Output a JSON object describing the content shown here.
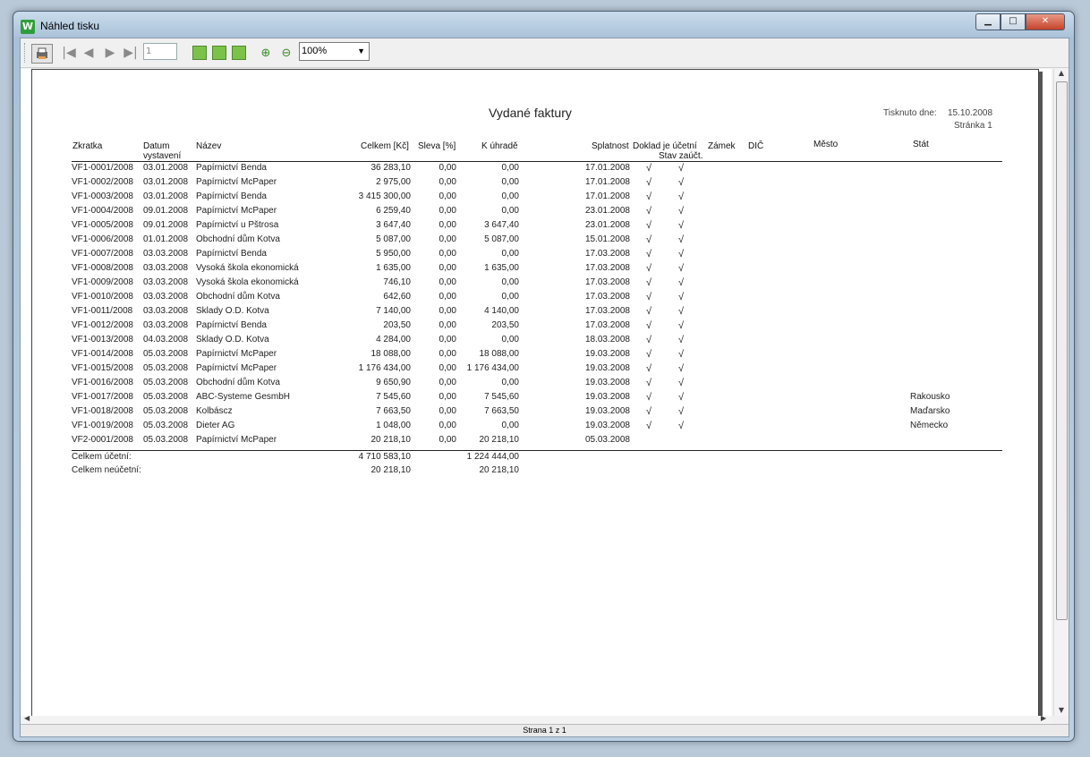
{
  "window": {
    "title": "Náhled tisku",
    "app_icon": "W"
  },
  "toolbar": {
    "page_value": "1",
    "zoom": "100%"
  },
  "report": {
    "title": "Vydané faktury",
    "printed_label": "Tisknuto dne:",
    "printed_date": "15.10.2008",
    "page_label": "Stránka 1",
    "headers": {
      "zkratka": "Zkratka",
      "datum": "Datum",
      "datum2": "vystavení",
      "nazev": "Název",
      "celkem": "Celkem [Kč]",
      "sleva": "Sleva [%]",
      "kuhrade": "K úhradě",
      "splatnost": "Splatnost",
      "doklad": "Doklad je účetní",
      "stav": "Stav zaúčt.",
      "zamek": "Zámek",
      "dic": "DIČ",
      "mesto": "Město",
      "stat": "Stát"
    },
    "rows": [
      {
        "z": "VF1-0001/2008",
        "d": "03.01.2008",
        "n": "Papírnictví Benda",
        "c": "36 283,10",
        "s": "0,00",
        "k": "0,00",
        "sp": "17.01.2008",
        "u": "√",
        "st": "√",
        "stat": ""
      },
      {
        "z": "VF1-0002/2008",
        "d": "03.01.2008",
        "n": "Papírnictví McPaper",
        "c": "2 975,00",
        "s": "0,00",
        "k": "0,00",
        "sp": "17.01.2008",
        "u": "√",
        "st": "√",
        "stat": ""
      },
      {
        "z": "VF1-0003/2008",
        "d": "03.01.2008",
        "n": "Papírnictví Benda",
        "c": "3 415 300,00",
        "s": "0,00",
        "k": "0,00",
        "sp": "17.01.2008",
        "u": "√",
        "st": "√",
        "stat": ""
      },
      {
        "z": "VF1-0004/2008",
        "d": "09.01.2008",
        "n": "Papírnictví McPaper",
        "c": "6 259,40",
        "s": "0,00",
        "k": "0,00",
        "sp": "23.01.2008",
        "u": "√",
        "st": "√",
        "stat": ""
      },
      {
        "z": "VF1-0005/2008",
        "d": "09.01.2008",
        "n": "Papírnictví u Pštrosa",
        "c": "3 647,40",
        "s": "0,00",
        "k": "3 647,40",
        "sp": "23.01.2008",
        "u": "√",
        "st": "√",
        "stat": ""
      },
      {
        "z": "VF1-0006/2008",
        "d": "01.01.2008",
        "n": "Obchodní dům Kotva",
        "c": "5 087,00",
        "s": "0,00",
        "k": "5 087,00",
        "sp": "15.01.2008",
        "u": "√",
        "st": "√",
        "stat": ""
      },
      {
        "z": "VF1-0007/2008",
        "d": "03.03.2008",
        "n": "Papírnictví Benda",
        "c": "5 950,00",
        "s": "0,00",
        "k": "0,00",
        "sp": "17.03.2008",
        "u": "√",
        "st": "√",
        "stat": ""
      },
      {
        "z": "VF1-0008/2008",
        "d": "03.03.2008",
        "n": "Vysoká škola ekonomická",
        "c": "1 635,00",
        "s": "0,00",
        "k": "1 635,00",
        "sp": "17.03.2008",
        "u": "√",
        "st": "√",
        "stat": ""
      },
      {
        "z": "VF1-0009/2008",
        "d": "03.03.2008",
        "n": "Vysoká škola ekonomická",
        "c": "746,10",
        "s": "0,00",
        "k": "0,00",
        "sp": "17.03.2008",
        "u": "√",
        "st": "√",
        "stat": ""
      },
      {
        "z": "VF1-0010/2008",
        "d": "03.03.2008",
        "n": "Obchodní dům Kotva",
        "c": "642,60",
        "s": "0,00",
        "k": "0,00",
        "sp": "17.03.2008",
        "u": "√",
        "st": "√",
        "stat": ""
      },
      {
        "z": "VF1-0011/2008",
        "d": "03.03.2008",
        "n": "Sklady O.D. Kotva",
        "c": "7 140,00",
        "s": "0,00",
        "k": "4 140,00",
        "sp": "17.03.2008",
        "u": "√",
        "st": "√",
        "stat": ""
      },
      {
        "z": "VF1-0012/2008",
        "d": "03.03.2008",
        "n": "Papírnictví Benda",
        "c": "203,50",
        "s": "0,00",
        "k": "203,50",
        "sp": "17.03.2008",
        "u": "√",
        "st": "√",
        "stat": ""
      },
      {
        "z": "VF1-0013/2008",
        "d": "04.03.2008",
        "n": "Sklady O.D. Kotva",
        "c": "4 284,00",
        "s": "0,00",
        "k": "0,00",
        "sp": "18.03.2008",
        "u": "√",
        "st": "√",
        "stat": ""
      },
      {
        "z": "VF1-0014/2008",
        "d": "05.03.2008",
        "n": "Papírnictví McPaper",
        "c": "18 088,00",
        "s": "0,00",
        "k": "18 088,00",
        "sp": "19.03.2008",
        "u": "√",
        "st": "√",
        "stat": ""
      },
      {
        "z": "VF1-0015/2008",
        "d": "05.03.2008",
        "n": "Papírnictví McPaper",
        "c": "1 176 434,00",
        "s": "0,00",
        "k": "1 176 434,00",
        "sp": "19.03.2008",
        "u": "√",
        "st": "√",
        "stat": ""
      },
      {
        "z": "VF1-0016/2008",
        "d": "05.03.2008",
        "n": "Obchodní dům Kotva",
        "c": "9 650,90",
        "s": "0,00",
        "k": "0,00",
        "sp": "19.03.2008",
        "u": "√",
        "st": "√",
        "stat": ""
      },
      {
        "z": "VF1-0017/2008",
        "d": "05.03.2008",
        "n": "ABC-Systeme GesmbH",
        "c": "7 545,60",
        "s": "0,00",
        "k": "7 545,60",
        "sp": "19.03.2008",
        "u": "√",
        "st": "√",
        "stat": "Rakousko"
      },
      {
        "z": "VF1-0018/2008",
        "d": "05.03.2008",
        "n": "Kolbáscz",
        "c": "7 663,50",
        "s": "0,00",
        "k": "7 663,50",
        "sp": "19.03.2008",
        "u": "√",
        "st": "√",
        "stat": "Maďarsko"
      },
      {
        "z": "VF1-0019/2008",
        "d": "05.03.2008",
        "n": "Dieter AG",
        "c": "1 048,00",
        "s": "0,00",
        "k": "0,00",
        "sp": "19.03.2008",
        "u": "√",
        "st": "√",
        "stat": "Německo"
      },
      {
        "z": "VF2-0001/2008",
        "d": "05.03.2008",
        "n": "Papírnictví McPaper",
        "c": "20 218,10",
        "s": "0,00",
        "k": "20 218,10",
        "sp": "05.03.2008",
        "u": "",
        "st": "",
        "stat": ""
      }
    ],
    "totals": {
      "ucetni_label": "Celkem účetní:",
      "ucetni_celkem": "4 710 583,10",
      "ucetni_kuhrade": "1 224 444,00",
      "neucetni_label": "Celkem neúčetní:",
      "neucetni_celkem": "20 218,10",
      "neucetni_kuhrade": "20 218,10"
    }
  },
  "status": {
    "text": "Strana 1 z 1"
  }
}
